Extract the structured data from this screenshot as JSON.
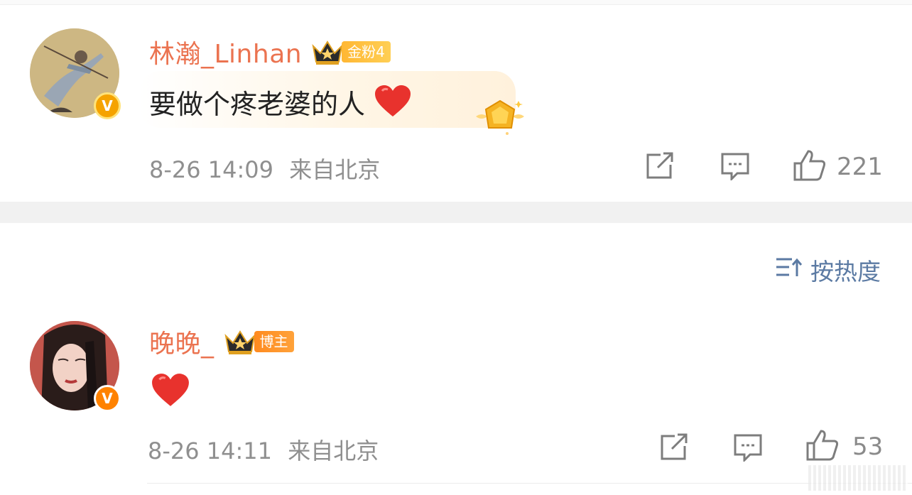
{
  "comments": [
    {
      "username": "林瀚_Linhan",
      "fan_badge": "金粉4",
      "text": "要做个疼老婆的人",
      "time": "8-26 14:09",
      "location": "来自北京",
      "like_count": "221"
    },
    {
      "username": "晚晚_",
      "fan_badge": "博主",
      "time": "8-26 14:11",
      "location": "来自北京",
      "like_count": "53"
    }
  ],
  "sort": {
    "label": "按热度"
  },
  "icons": {
    "verified": "verified-v-icon",
    "crown": "crown-icon",
    "heart": "red-heart-emoji",
    "share": "share-icon",
    "comment": "comment-icon",
    "like": "thumbs-up-icon",
    "sort": "sort-icon",
    "medal": "gold-medal-icon"
  },
  "colors": {
    "username": "#eb7350",
    "meta": "#8f8f8f",
    "sort": "#5b7aa3",
    "verified": "#ff8200",
    "heart": "#e8322d"
  }
}
